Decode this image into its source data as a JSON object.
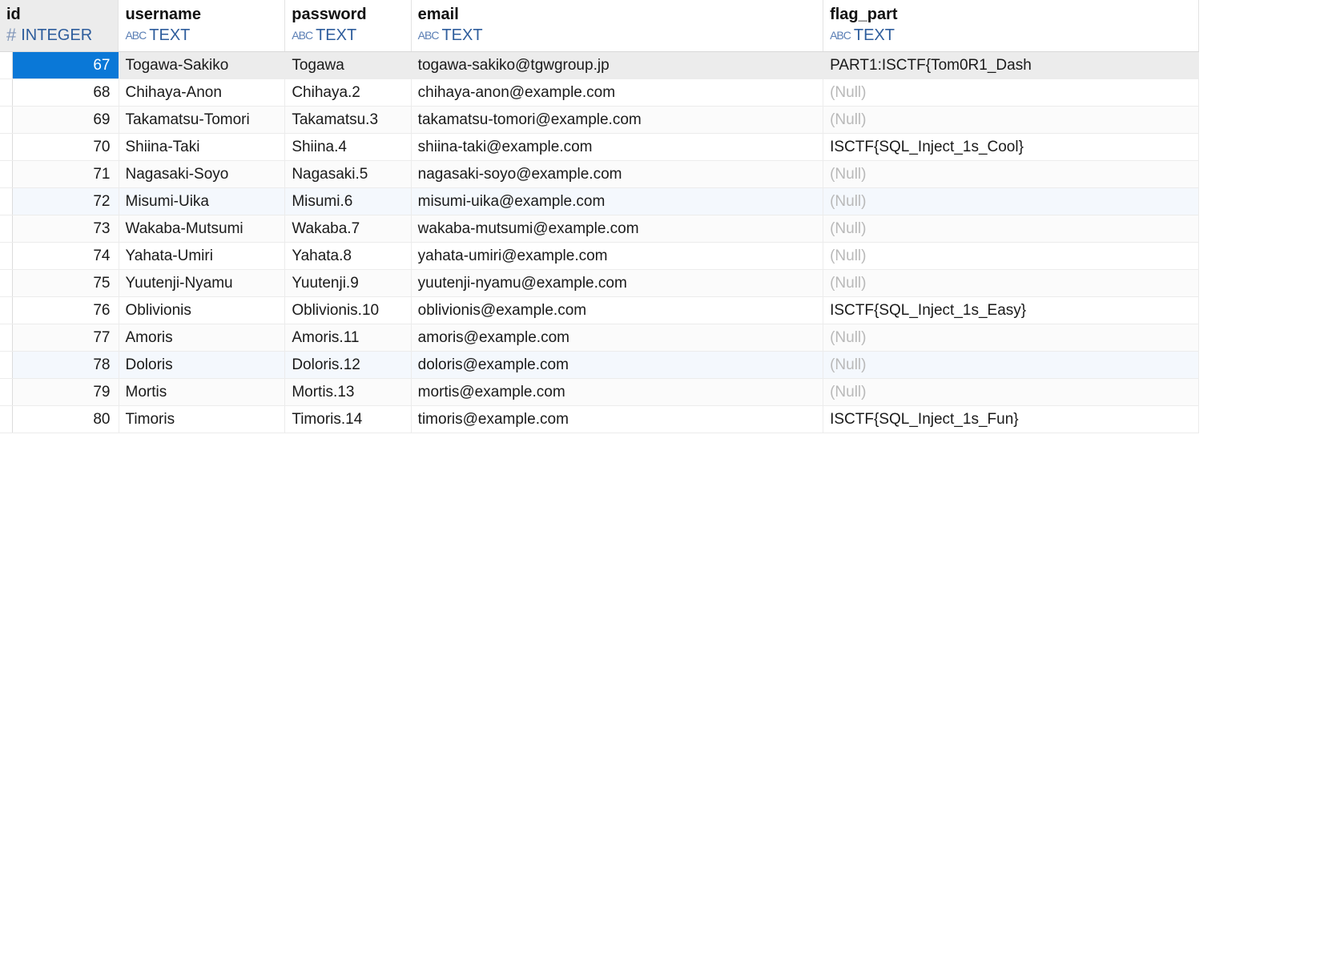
{
  "columns": [
    {
      "name": "id",
      "type": "INTEGER",
      "icon": "hash-icon"
    },
    {
      "name": "username",
      "type": "TEXT",
      "icon": "abc-icon"
    },
    {
      "name": "password",
      "type": "TEXT",
      "icon": "abc-icon"
    },
    {
      "name": "email",
      "type": "TEXT",
      "icon": "abc-icon"
    },
    {
      "name": "flag_part",
      "type": "TEXT",
      "icon": "abc-icon"
    }
  ],
  "icons": {
    "hash": "#",
    "abc": "ABC"
  },
  "rows": [
    {
      "id": "67",
      "username": "Togawa-Sakiko",
      "password": "Togawa",
      "email": "togawa-sakiko@tgwgroup.jp",
      "flag_part": "PART1:ISCTF{Tom0R1_Dash"
    },
    {
      "id": "68",
      "username": "Chihaya-Anon",
      "password": "Chihaya.2",
      "email": "chihaya-anon@example.com",
      "flag_part": "(Null)"
    },
    {
      "id": "69",
      "username": "Takamatsu-Tomori",
      "password": "Takamatsu.3",
      "email": "takamatsu-tomori@example.com",
      "flag_part": "(Null)"
    },
    {
      "id": "70",
      "username": "Shiina-Taki",
      "password": "Shiina.4",
      "email": "shiina-taki@example.com",
      "flag_part": "ISCTF{SQL_Inject_1s_Cool}"
    },
    {
      "id": "71",
      "username": "Nagasaki-Soyo",
      "password": "Nagasaki.5",
      "email": "nagasaki-soyo@example.com",
      "flag_part": "(Null)"
    },
    {
      "id": "72",
      "username": "Misumi-Uika",
      "password": "Misumi.6",
      "email": "misumi-uika@example.com",
      "flag_part": "(Null)"
    },
    {
      "id": "73",
      "username": "Wakaba-Mutsumi",
      "password": "Wakaba.7",
      "email": "wakaba-mutsumi@example.com",
      "flag_part": "(Null)"
    },
    {
      "id": "74",
      "username": "Yahata-Umiri",
      "password": "Yahata.8",
      "email": "yahata-umiri@example.com",
      "flag_part": "(Null)"
    },
    {
      "id": "75",
      "username": "Yuutenji-Nyamu",
      "password": "Yuutenji.9",
      "email": "yuutenji-nyamu@example.com",
      "flag_part": "(Null)"
    },
    {
      "id": "76",
      "username": "Oblivionis",
      "password": "Oblivionis.10",
      "email": "oblivionis@example.com",
      "flag_part": "ISCTF{SQL_Inject_1s_Easy}"
    },
    {
      "id": "77",
      "username": "Amoris",
      "password": "Amoris.11",
      "email": "amoris@example.com",
      "flag_part": "(Null)"
    },
    {
      "id": "78",
      "username": "Doloris",
      "password": "Doloris.12",
      "email": "doloris@example.com",
      "flag_part": "(Null)"
    },
    {
      "id": "79",
      "username": "Mortis",
      "password": "Mortis.13",
      "email": "mortis@example.com",
      "flag_part": "(Null)"
    },
    {
      "id": "80",
      "username": "Timoris",
      "password": "Timoris.14",
      "email": "timoris@example.com",
      "flag_part": "ISCTF{SQL_Inject_1s_Fun}"
    }
  ],
  "colors": {
    "selection": "#0a78d7",
    "type_text": "#2e5d9c",
    "null_text": "#b9b9b9"
  }
}
